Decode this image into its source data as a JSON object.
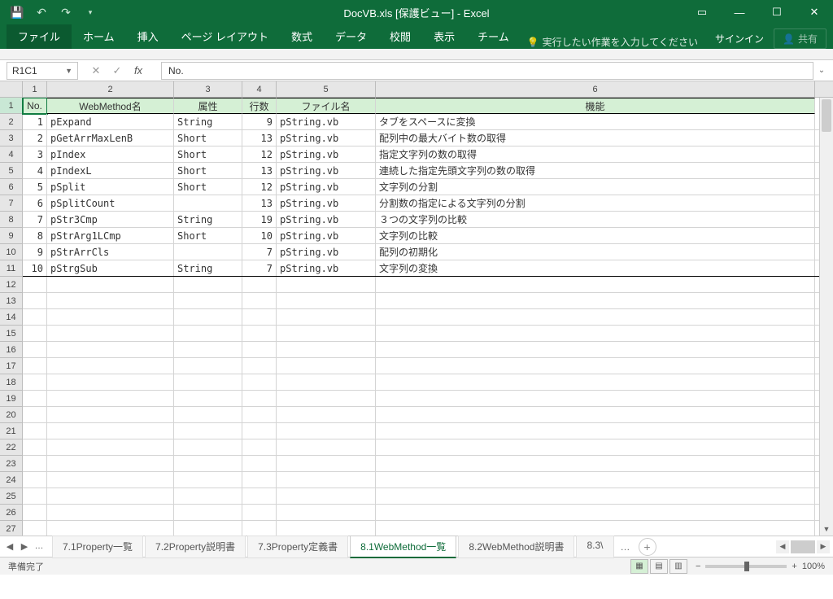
{
  "titlebar": {
    "title": "DocVB.xls  [保護ビュー] - Excel"
  },
  "ribbon": {
    "tabs": [
      "ファイル",
      "ホーム",
      "挿入",
      "ページ レイアウト",
      "数式",
      "データ",
      "校閲",
      "表示",
      "チーム"
    ],
    "tell_me": "実行したい作業を入力してください",
    "signin": "サインイン",
    "share": "共有"
  },
  "formula": {
    "namebox": "R1C1",
    "value": "No."
  },
  "col_numbers": [
    "1",
    "2",
    "3",
    "4",
    "5",
    "6"
  ],
  "headers": [
    "No.",
    "WebMethod名",
    "属性",
    "行数",
    "ファイル名",
    "機能"
  ],
  "rows": [
    {
      "no": "1",
      "name": "pExpand",
      "attr": "String",
      "lines": "9",
      "file": "pString.vb",
      "func": "タブをスペースに変換"
    },
    {
      "no": "2",
      "name": "pGetArrMaxLenB",
      "attr": "Short",
      "lines": "13",
      "file": "pString.vb",
      "func": "配列中の最大バイト数の取得"
    },
    {
      "no": "3",
      "name": "pIndex",
      "attr": "Short",
      "lines": "12",
      "file": "pString.vb",
      "func": "指定文字列の数の取得"
    },
    {
      "no": "4",
      "name": "pIndexL",
      "attr": "Short",
      "lines": "13",
      "file": "pString.vb",
      "func": "連続した指定先頭文字列の数の取得"
    },
    {
      "no": "5",
      "name": "pSplit",
      "attr": "Short",
      "lines": "12",
      "file": "pString.vb",
      "func": "文字列の分割"
    },
    {
      "no": "6",
      "name": "pSplitCount",
      "attr": "",
      "lines": "13",
      "file": "pString.vb",
      "func": "分割数の指定による文字列の分割"
    },
    {
      "no": "7",
      "name": "pStr3Cmp",
      "attr": "String",
      "lines": "19",
      "file": "pString.vb",
      "func": "３つの文字列の比較"
    },
    {
      "no": "8",
      "name": "pStrArg1LCmp",
      "attr": "Short",
      "lines": "10",
      "file": "pString.vb",
      "func": "文字列の比較"
    },
    {
      "no": "9",
      "name": "pStrArrCls",
      "attr": "",
      "lines": "7",
      "file": "pString.vb",
      "func": "配列の初期化"
    },
    {
      "no": "10",
      "name": "pStrgSub",
      "attr": "String",
      "lines": "7",
      "file": "pString.vb",
      "func": "文字列の変換"
    }
  ],
  "empty_rows": 16,
  "sheet_tabs": {
    "items": [
      "7.1Property一覧",
      "7.2Property説明書",
      "7.3Property定義書",
      "8.1WebMethod一覧",
      "8.2WebMethod説明書",
      "8.3\\"
    ],
    "active_index": 3
  },
  "status": {
    "ready": "準備完了",
    "zoom": "100%"
  }
}
